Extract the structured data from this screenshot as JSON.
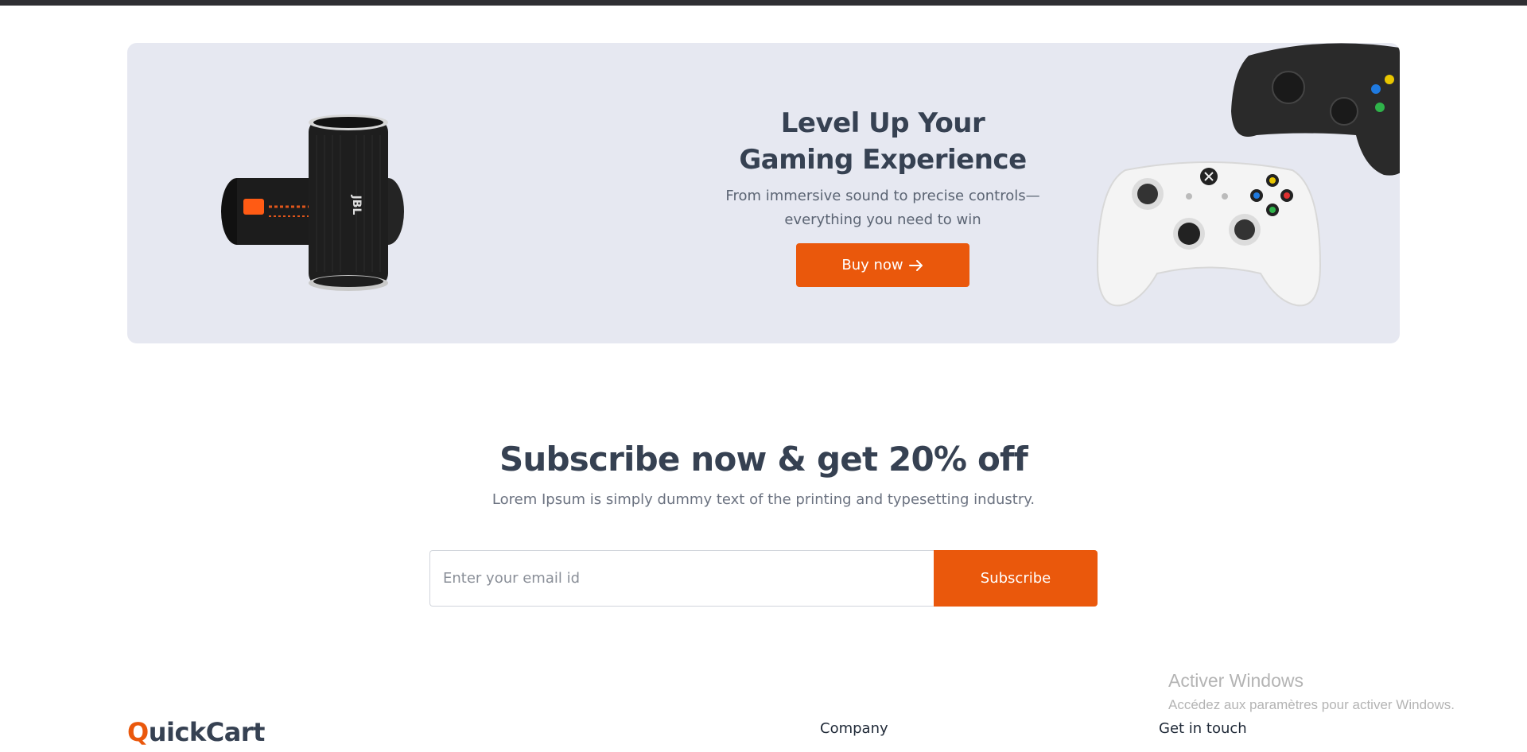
{
  "banner": {
    "title_line1": "Level Up Your",
    "title_line2": "Gaming Experience",
    "subtitle_line1": "From immersive sound to precise controls—",
    "subtitle_line2": "everything you need to win",
    "button_label": "Buy now",
    "button_icon": "arrow-right-icon",
    "speaker_brand": "JBL"
  },
  "subscribe": {
    "title": "Subscribe now & get 20% off",
    "description": "Lorem Ipsum is simply dummy text of the printing and typesetting industry.",
    "email_placeholder": "Enter your email id",
    "button_label": "Subscribe"
  },
  "footer": {
    "logo_first_letter": "Q",
    "logo_rest": "uickCart",
    "col_company": "Company",
    "col_contact": "Get in touch"
  },
  "watermark": {
    "title": "Activer Windows",
    "subtitle": "Accédez aux paramètres pour activer Windows."
  },
  "colors": {
    "accent": "#ea580c",
    "banner_bg": "#e6e8f1",
    "heading": "#364152"
  }
}
